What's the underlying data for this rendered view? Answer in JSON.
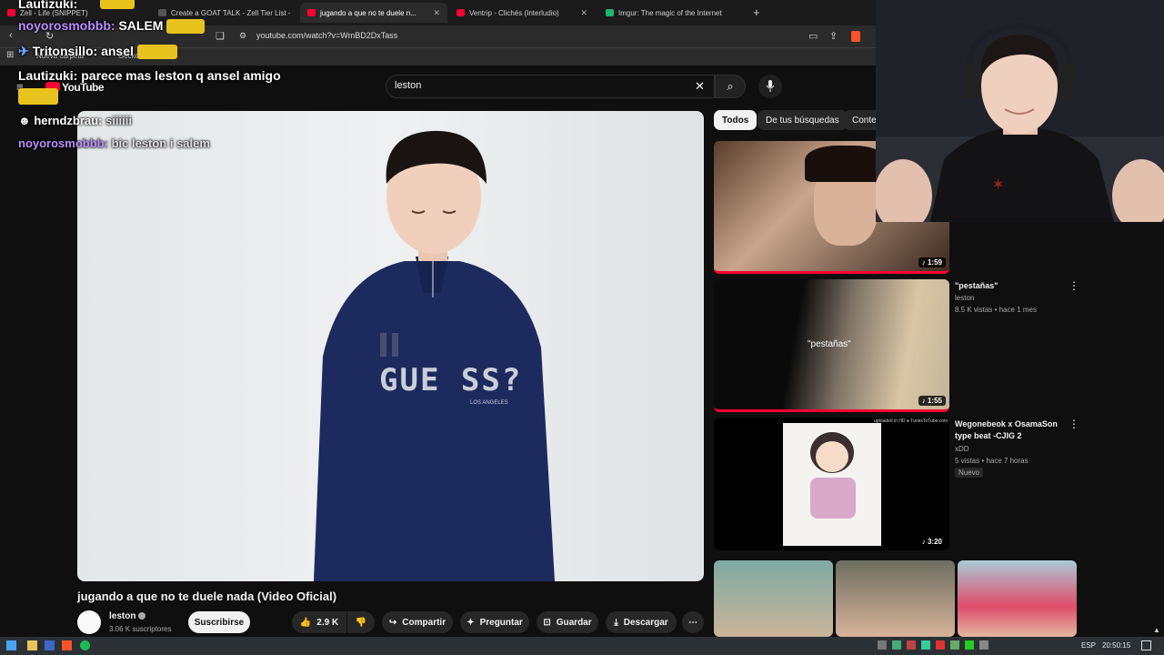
{
  "browser": {
    "tabs": [
      {
        "label": "Zell - Life (SNIPPET)",
        "color": "#ff0033"
      },
      {
        "label": "Create a GOAT TALK - Zell Tier List -",
        "color": "#2b2b2b"
      },
      {
        "label": "jugando a que no te duele n...",
        "color": "#ff0033"
      },
      {
        "label": "Ventrip - Clichés (Interludio)",
        "color": "#ff0033"
      },
      {
        "label": "Imgur: The magic of the Internet",
        "color": "#1bb76e"
      }
    ],
    "url": "youtube.com/watch?v=WmBD2DxTass",
    "bookmarks": [
      "Nueva carpeta",
      "Gecko"
    ]
  },
  "youtube": {
    "logo": "YouTube",
    "search_value": "leston",
    "video_title": "jugando a que no te duele nada (Video Oficial)",
    "channel": {
      "name": "leston",
      "subs": "3.06 K suscriptores",
      "subscribe": "Suscribirse"
    },
    "actions": {
      "likes": "2.9 K",
      "share": "Compartir",
      "ask": "Preguntar",
      "save": "Guardar",
      "download": "Descargar"
    },
    "chips": [
      "Todos",
      "De tus búsquedas",
      "Conter"
    ],
    "recommendations": [
      {
        "duration": "1:59"
      },
      {
        "title": "\"pestañas\"",
        "channel": "leston",
        "meta": "8.5 K vistas • hace 1 mes",
        "duration": "1:55",
        "thumb_text": "\"pestañas\""
      },
      {
        "title": "Wegonebeok x OsamaSon type beat -CJIG 2",
        "channel": "xDD",
        "meta": "5 vistas • hace 7 horas",
        "badge": "Nuevo",
        "duration": "3:20",
        "thumb_text": "uploaded in HD ● TunesToTube.com"
      }
    ],
    "shirt_text": "GUE SS?",
    "shirt_sub": "LOS ANGELES"
  },
  "chat": [
    {
      "user": "Lautizuki:",
      "msg": "",
      "class": "u1"
    },
    {
      "user": "noyorosmobbb:",
      "msg": "SALEM",
      "class": "u2"
    },
    {
      "user": "Tritonsillo:",
      "msg": "ansel",
      "class": "u1"
    },
    {
      "user": "Lautizuki:",
      "msg": "parece mas leston q ansel amigo",
      "class": "u1"
    },
    {
      "user": "herndzbrau:",
      "msg": "siiiiii",
      "class": "u1"
    },
    {
      "user": "noyorosmobbb:",
      "msg": "bic leston i salem",
      "class": "u2"
    }
  ],
  "taskbar": {
    "lang": "ESP",
    "time": "20:50:15"
  }
}
